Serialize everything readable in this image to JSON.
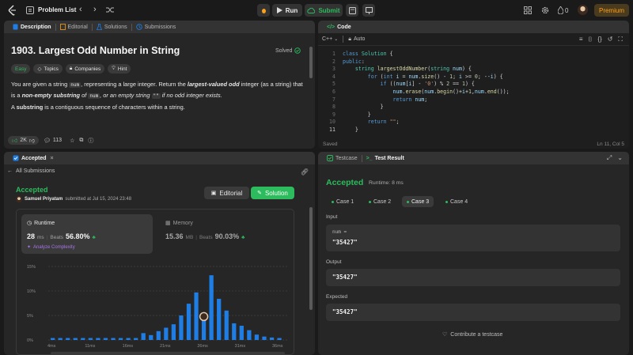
{
  "nav": {
    "problem_list": "Problem List",
    "run": "Run",
    "submit": "Submit",
    "streak": "0",
    "premium": "Premium"
  },
  "desc_panel": {
    "tabs": [
      "Description",
      "Editorial",
      "Solutions",
      "Submissions"
    ],
    "title": "1903. Largest Odd Number in String",
    "solved": "Solved",
    "tags": [
      "Easy",
      "Topics",
      "Companies",
      "Hint"
    ],
    "p1": {
      "a": "You are given a string ",
      "b": "num",
      "c": ", representing a large integer. Return the ",
      "d": "largest-valued odd",
      "e": " integer (as a string) that",
      "f": "is a ",
      "g": "non-empty substring",
      "h": " of ",
      "i": "num",
      "j": ", or an empty string ",
      "k": "\"\"",
      "l": " if no odd integer exists."
    },
    "p2": {
      "a": "A ",
      "b": "substring",
      "c": " is a contiguous sequence of characters within a string."
    },
    "likes": "2K",
    "comments": "113"
  },
  "code_panel": {
    "tab": "Code",
    "language": "C++",
    "auto": "Auto",
    "status": "Saved",
    "cursor": "Ln 11, Col 5",
    "lines": [
      "1",
      "2",
      "3",
      "4",
      "5",
      "6",
      "7",
      "8",
      "9",
      "10",
      "11"
    ]
  },
  "accepted_panel": {
    "tab": "Accepted",
    "back": "All Submissions",
    "status": "Accepted",
    "author": "Samuel Priyatam",
    "submitted": "submitted at Jul 15, 2024 23:48",
    "editorial": "Editorial",
    "solution": "Solution",
    "runtime_label": "Runtime",
    "runtime_value": "28",
    "runtime_unit": "ms",
    "runtime_beats_label": "Beats",
    "runtime_beats": "56.80%",
    "analyze": "Analyze Complexity",
    "memory_label": "Memory",
    "memory_value": "15.36",
    "memory_unit": "MB",
    "memory_beats_label": "Beats",
    "memory_beats": "90.03%"
  },
  "chart_data": {
    "type": "bar",
    "yticks": [
      "15%",
      "10%",
      "5%",
      "0%"
    ],
    "xticks": [
      "4ms",
      "11ms",
      "16ms",
      "21ms",
      "26ms",
      "31ms",
      "36ms"
    ],
    "ylim": [
      0,
      15
    ],
    "values": [
      0.4,
      0.4,
      0.4,
      0.4,
      0.4,
      0.4,
      0.4,
      0.4,
      0.4,
      0.4,
      0.4,
      0.4,
      1.4,
      1.0,
      1.8,
      2.5,
      3.2,
      5.0,
      7.4,
      9.7,
      5.1,
      13.2,
      8.4,
      6.0,
      3.4,
      2.9,
      2.0,
      1.1,
      0.7,
      0.5,
      0.4
    ],
    "highlight_index": 20,
    "color": "#1e7ee6"
  },
  "test_panel": {
    "tabs": [
      "Testcase",
      "Test Result"
    ],
    "status": "Accepted",
    "runtime": "Runtime: 8 ms",
    "cases": [
      "Case 1",
      "Case 2",
      "Case 3",
      "Case 4"
    ],
    "input_label": "Input",
    "input_name": "num =",
    "input_value": "\"35427\"",
    "output_label": "Output",
    "output_value": "\"35427\"",
    "expected_label": "Expected",
    "expected_value": "\"35427\"",
    "contribute": "Contribute a testcase"
  },
  "colors": {
    "accent_green": "#2cbb5d",
    "premium": "#ffa116",
    "bar_blue": "#1e7ee6"
  }
}
